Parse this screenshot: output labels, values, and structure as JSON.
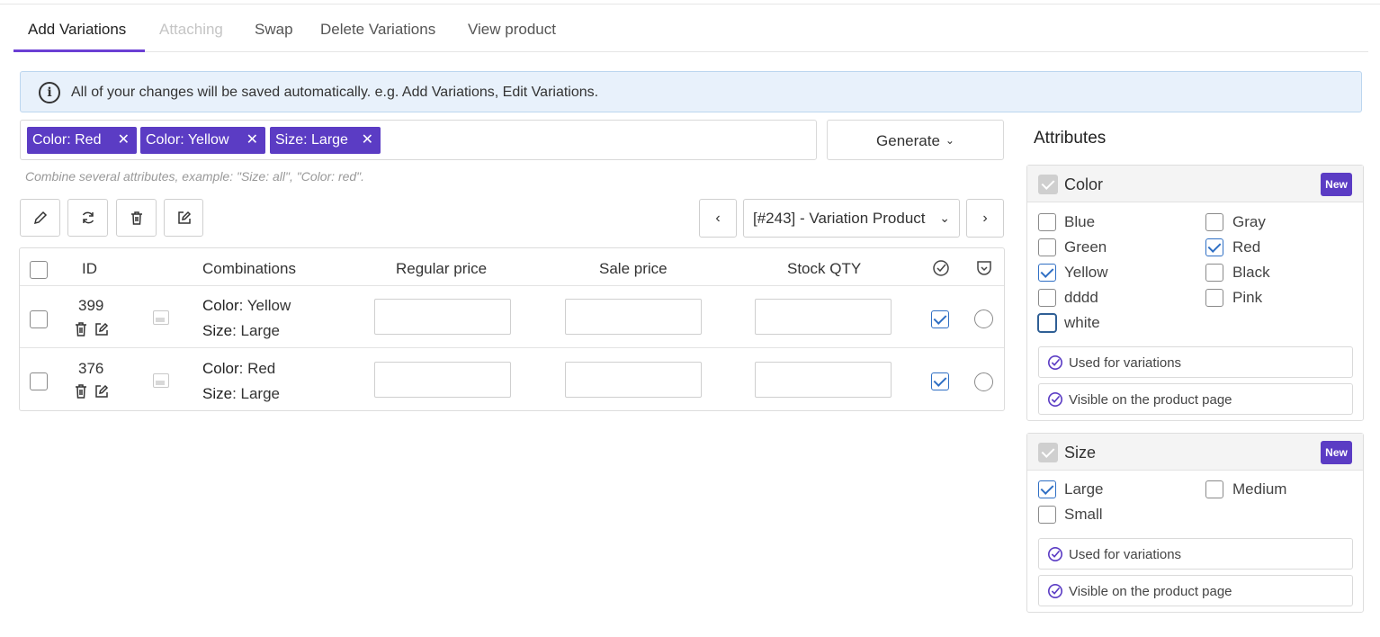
{
  "tabs": [
    {
      "label": "Add Variations"
    },
    {
      "label": "Attaching"
    },
    {
      "label": "Swap"
    },
    {
      "label": "Delete Variations"
    },
    {
      "label": "View product"
    }
  ],
  "notice": {
    "icon": "info-icon",
    "text": "All of your changes will be saved automatically. e.g. Add Variations, Edit Variations."
  },
  "tags": [
    {
      "label": "Color: Red"
    },
    {
      "label": "Color: Yellow"
    },
    {
      "label": "Size: Large"
    }
  ],
  "generate": {
    "label": "Generate",
    "chevron": "⌄"
  },
  "hint": "Combine several attributes, example: \"Size: all\", \"Color: red\".",
  "toolbar": {
    "icons": [
      "edit-pencil-icon",
      "refresh-icon",
      "trash-icon",
      "edit-square-icon"
    ]
  },
  "pager": {
    "prev": "‹",
    "next": "›",
    "selected": "[#243] - Variation Product",
    "chevron": "⌄"
  },
  "table": {
    "headers": {
      "id": "ID",
      "combinations": "Combinations",
      "regular_price": "Regular price",
      "sale_price": "Sale price",
      "stock_qty": "Stock QTY"
    },
    "rows": [
      {
        "id": "399",
        "attr1_name": "Color",
        "attr1_value": ": Yellow",
        "attr2_name": "Size",
        "attr2_value": ": Large",
        "regular_price": "",
        "sale_price": "",
        "stock_qty": "",
        "enabled": true,
        "default": false
      },
      {
        "id": "376",
        "attr1_name": "Color",
        "attr1_value": ": Red",
        "attr2_name": "Size",
        "attr2_value": ": Large",
        "regular_price": "",
        "sale_price": "",
        "stock_qty": "",
        "enabled": true,
        "default": false
      }
    ]
  },
  "attributes": {
    "title": "Attributes",
    "groups": [
      {
        "name": "Color",
        "badge": "New",
        "options": [
          {
            "label": "Blue",
            "checked": false
          },
          {
            "label": "Gray",
            "checked": false
          },
          {
            "label": "Green",
            "checked": false
          },
          {
            "label": "Red",
            "checked": true
          },
          {
            "label": "Yellow",
            "checked": true
          },
          {
            "label": "Black",
            "checked": false
          },
          {
            "label": "dddd",
            "checked": false
          },
          {
            "label": "Pink",
            "checked": false
          },
          {
            "label": "white",
            "checked": false
          }
        ],
        "flags": [
          {
            "label": "Used for variations"
          },
          {
            "label": "Visible on the product page"
          }
        ]
      },
      {
        "name": "Size",
        "badge": "New",
        "options": [
          {
            "label": "Large",
            "checked": true
          },
          {
            "label": "Medium",
            "checked": false
          },
          {
            "label": "Small",
            "checked": false
          }
        ],
        "flags": [
          {
            "label": "Used for variations"
          },
          {
            "label": "Visible on the product page"
          }
        ]
      }
    ]
  },
  "colors": {
    "accent": "#5b3cc4",
    "check": "#2f6fc4",
    "notice_bg": "#e8f1fb"
  }
}
